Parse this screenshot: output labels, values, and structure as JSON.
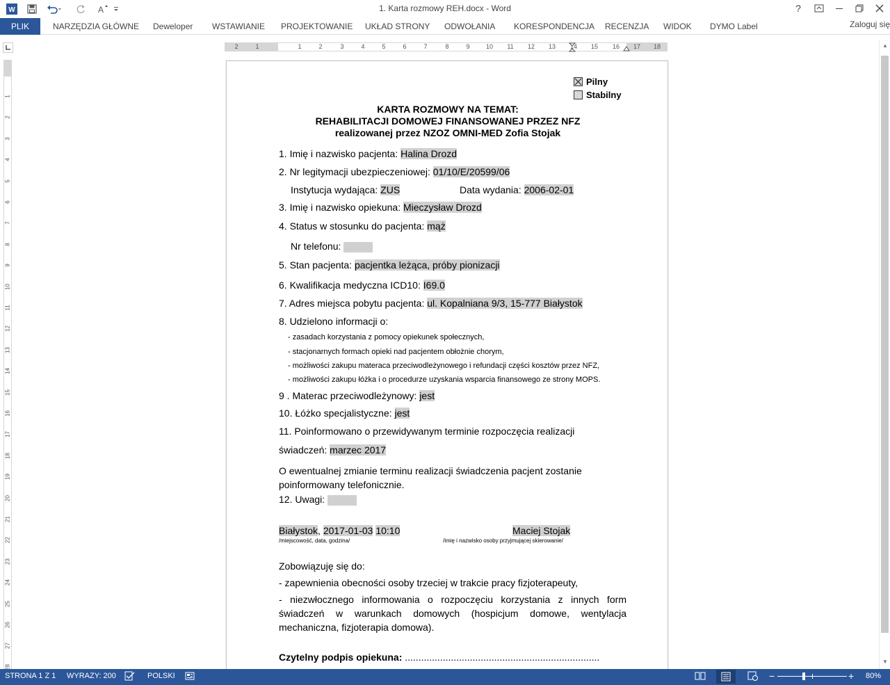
{
  "titlebar": {
    "title": "1. Karta rozmowy REH.docx - Word",
    "help": "?",
    "restore": "🗗",
    "minimize": "─",
    "maximize": "🗖",
    "close": "✕"
  },
  "ribbon": {
    "file": "PLIK",
    "tabs": [
      "NARZĘDZIA GŁÓWNE",
      "Deweloper",
      "WSTAWIANIE",
      "PROJEKTOWANIE",
      "UKŁAD STRONY",
      "ODWOŁANIA",
      "KORESPONDENCJA",
      "RECENZJA",
      "WIDOK",
      "DYMO Label"
    ],
    "signin": "Zaloguj się"
  },
  "ruler": {
    "h_numbers": [
      "2",
      "1",
      "1",
      "2",
      "3",
      "4",
      "5",
      "6",
      "7",
      "8",
      "9",
      "10",
      "11",
      "12",
      "13",
      "14",
      "15",
      "16",
      "17",
      "18"
    ],
    "v_numbers": [
      "1",
      "2",
      "3",
      "4",
      "5",
      "6",
      "7",
      "8",
      "9",
      "10",
      "11",
      "12",
      "13",
      "14",
      "15",
      "16",
      "17",
      "18",
      "19",
      "20",
      "21",
      "22",
      "23",
      "24",
      "25",
      "26",
      "27",
      "28"
    ]
  },
  "document": {
    "checkbox_urgent": "Pilny",
    "checkbox_stable": "Stabilny",
    "urgent_checked": true,
    "title_line1": "KARTA  ROZMOWY NA TEMAT:",
    "title_line2": "REHABILITACJI DOMOWEJ FINANSOWANEJ PRZEZ NFZ",
    "title_line3": "realizowanej przez NZOZ OMNI-MED Zofia Stojak",
    "q1_label": "1. Imię i nazwisko pacjenta: ",
    "q1_value": "Halina Drozd",
    "q2_label": "2. Nr legitymacji ubezpieczeniowej: ",
    "q2_value": "01/10/E/20599/06",
    "inst_label": "Instytucja wydająca:  ",
    "inst_value": "ZUS",
    "date_label": "Data wydania: ",
    "date_value": "2006-02-01",
    "q3_label": "3. Imię i nazwisko opiekuna: ",
    "q3_value": "Mieczysław Drozd",
    "q4_label": "4. Status w stosunku do pacjenta: ",
    "q4_value": "mąż",
    "phone_label": "Nr telefonu: ",
    "q5_label": "5. Stan pacjenta: ",
    "q5_value": "pacjentka leżąca, próby pionizacji",
    "q6_label": "6. Kwalifikacja medyczna ICD10: ",
    "q6_value": "I69.0",
    "q7_label": "7. Adres miejsca pobytu pacjenta: ",
    "q7_value": "ul. Kopalniana 9/3, 15-777 Białystok",
    "q8_label": "8. Udzielono informacji o:",
    "q8_items": [
      "- zasadach korzystania z pomocy opiekunek społecznych,",
      "- stacjonarnych formach opieki nad pacjentem obłożnie chorym,",
      "- możliwości zakupu materaca przeciwodleżynowego i refundacji części kosztów przez NFZ,",
      "- możliwości zakupu łóżka i o procedurze uzyskania wsparcia finansowego ze strony MOPS."
    ],
    "q9_label": "9 . Materac przeciwodleżynowy: ",
    "q9_value": "jest",
    "q10_label": "10. Łóżko specjalistyczne: ",
    "q10_value": "jest",
    "q11_label": "11. Poinformowano o przewidywanym terminie rozpoczęcia realizacji",
    "q11_label2": "świadczeń: ",
    "q11_value": "marzec 2017",
    "note": "O ewentualnej zmianie terminu realizacji  świadczenia pacjent zostanie poinformowany telefonicznie.",
    "q12_label": "12. Uwagi: ",
    "place": "Białystok",
    "place_sep": ", ",
    "datetime_date": "2017-01-03",
    "datetime_time": "10:10",
    "place_caption": "/miejscowość, data, godzina/",
    "person": "Maciej Stojak",
    "person_caption": "/imię i nazwisko osoby przyjmującej skierowanie/",
    "commit_label": "Zobowiązuję się do:",
    "commit1": "- zapewnienia obecności osoby trzeciej w trakcie pracy fizjoterapeuty,",
    "commit2": "- niezwłocznego informowania o rozpoczęciu korzystania z innych form świadczeń w warunkach domowych (hospicjum domowe, wentylacja mechaniczna, fizjoterapia domowa).",
    "signature_label": "Czytelny podpis opiekuna: ",
    "signature_dots": "........................................................................"
  },
  "status": {
    "page": "STRONA 1 Z 1",
    "words": "WYRAZY: 200",
    "language": "POLSKI",
    "zoom": "80%",
    "zoom_minus": "−",
    "zoom_plus": "+"
  },
  "colors": {
    "accent": "#2b579a",
    "field_highlight": "#d0d0d0"
  }
}
